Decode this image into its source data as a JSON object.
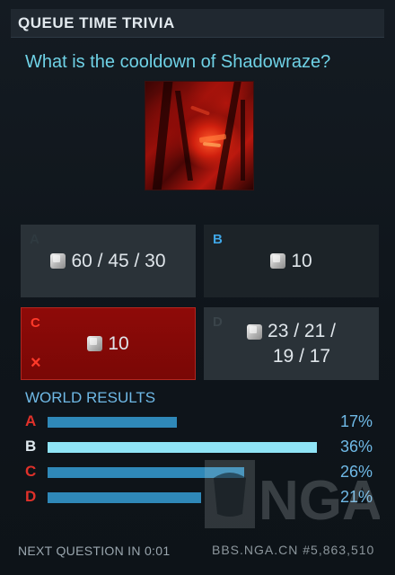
{
  "header": {
    "title": "QUEUE TIME TRIVIA"
  },
  "question": {
    "text": "What is the cooldown of Shadowraze?",
    "icon": "shadowraze-spell-icon"
  },
  "answers": [
    {
      "letter": "A",
      "value": "60 / 45 / 30",
      "state": "default",
      "letter_color": "#2a343a"
    },
    {
      "letter": "B",
      "value": "10",
      "state": "correct",
      "letter_color": "#3fa6e6"
    },
    {
      "letter": "C",
      "value": "10",
      "state": "selected-wrong",
      "letter_color": "#ff3a2a",
      "mark": "×"
    },
    {
      "letter": "D",
      "value": "23 / 21 /\n19 / 17",
      "state": "default",
      "letter_color": "#3a444a"
    }
  ],
  "results": {
    "title": "WORLD RESULTS",
    "rows": [
      {
        "letter": "A",
        "pct_label": "17%",
        "fill": 0.48,
        "letter_color": "#e0312a",
        "bar_color": "#2f88b8"
      },
      {
        "letter": "B",
        "pct_label": "36%",
        "fill": 1.0,
        "letter_color": "#dfe8ee",
        "bar_color": "#8fe4f6"
      },
      {
        "letter": "C",
        "pct_label": "26%",
        "fill": 0.73,
        "letter_color": "#e0312a",
        "bar_color": "#2f88b8"
      },
      {
        "letter": "D",
        "pct_label": "21%",
        "fill": 0.57,
        "letter_color": "#e0312a",
        "bar_color": "#2f88b8"
      }
    ]
  },
  "footer": {
    "next_label": "NEXT QUESTION IN 0:01"
  },
  "watermark": {
    "logo_text": "NGA",
    "site_text": "BBS.NGA.CN",
    "id_text": "#5,863,510"
  },
  "colors": {
    "accent": "#6fd2e6",
    "wrong": "#8e0a08",
    "bar": "#2f88b8",
    "bar_highlight": "#8fe4f6"
  }
}
